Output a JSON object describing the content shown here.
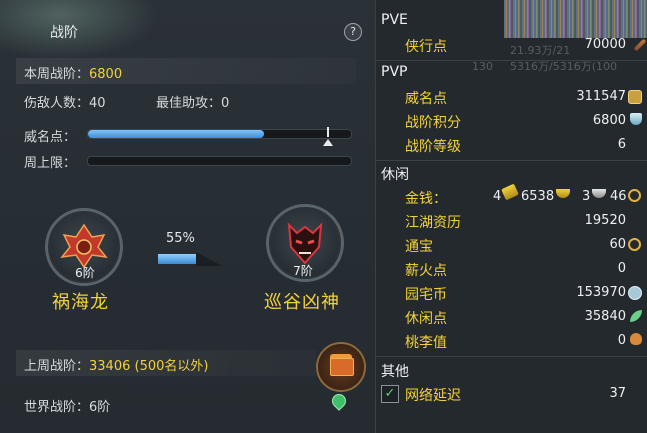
{
  "left": {
    "title": "战阶",
    "help": "?",
    "weekly_rank_label": "本周战阶：",
    "weekly_rank_value": "6800",
    "kills_label": "伤敌人数：",
    "kills_value": "40",
    "assists_label": "最佳助攻：",
    "assists_value": "0",
    "prestige_label": "威名点：",
    "weekly_limit_label": "周上限：",
    "prestige_progress": 0.67,
    "weekly_limit_progress": 0,
    "current_tier": {
      "tier": "6阶",
      "name": "祸海龙"
    },
    "progress_percent_text": "55%",
    "progress_percent": 0.55,
    "next_tier": {
      "tier": "7阶",
      "name": "巡谷凶神"
    },
    "last_week_label": "上周战阶：",
    "last_week_value": "33406 (500名以外)",
    "world_rank_label": "世界战阶：",
    "world_rank_value": "6阶"
  },
  "right": {
    "pve_title": "PVE",
    "pve_items": [
      {
        "label": "侠行点",
        "value": "70000",
        "icon": "sword-icon"
      }
    ],
    "pvp_title": "PVP",
    "pvp_items": [
      {
        "label": "威名点",
        "value": "311547",
        "icon": "badge-icon"
      },
      {
        "label": "战阶积分",
        "value": "6800",
        "icon": "crystal-icon"
      },
      {
        "label": "战阶等级",
        "value": "6"
      }
    ],
    "leisure_title": "休闲",
    "money_label": "金钱：",
    "money_gold": "4",
    "money_silver": "6538",
    "money_copper": "3",
    "money_coin": "46",
    "leisure_items": [
      {
        "label": "江湖资历",
        "value": "19520"
      },
      {
        "label": "通宝",
        "value": "60",
        "icon": "coin-icon"
      },
      {
        "label": "薪火点",
        "value": "0"
      },
      {
        "label": "园宅币",
        "value": "153970",
        "icon": "house-coin-icon"
      },
      {
        "label": "休闲点",
        "value": "35840",
        "icon": "leaf-icon"
      },
      {
        "label": "桃李值",
        "value": "0",
        "icon": "gourd-icon"
      }
    ],
    "other_title": "其他",
    "latency_label": "网络延迟",
    "latency_value": "37",
    "ghost_text_1": "21.93万/21",
    "ghost_text_2": "5316万/5316万(100",
    "ghost_text_3": "130"
  },
  "colors": {
    "accent_yellow": "#f2d23c",
    "bar_blue": "#3c8fd8",
    "panel_dark": "#24292d"
  }
}
